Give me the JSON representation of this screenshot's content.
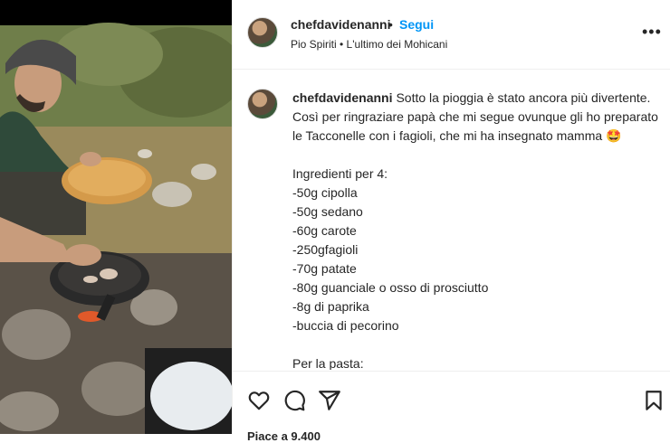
{
  "post": {
    "author": "chefdavidenanni",
    "follow_label": "Segui",
    "audio": "Pio Spiriti • L'ultimo dei Mohicani"
  },
  "caption": {
    "author": "chefdavidenanni",
    "intro_lines": [
      "Sotto la pioggia è stato ancora più divertente.",
      "Così per ringraziare papà che mi segue ovunque gli ho preparato",
      "le Tacconelle con i fagioli, che mi ha insegnato mamma 🤩"
    ],
    "ingredients_title": "Ingredienti per 4:",
    "ingredients": [
      "-50g cipolla",
      "-50g sedano",
      "-60g carote",
      "-250gfagioli",
      "-70g patate",
      "-80g guanciale o osso di prosciutto",
      "-8g di paprika",
      "-buccia di pecorino"
    ],
    "pasta_title": "Per la pasta:"
  },
  "actions": {
    "likes_partial": "Piace a 9.400"
  },
  "icons": {
    "like": "heart-icon",
    "comment": "comment-icon",
    "share": "share-icon",
    "save": "bookmark-icon",
    "more": "more-options-icon"
  }
}
